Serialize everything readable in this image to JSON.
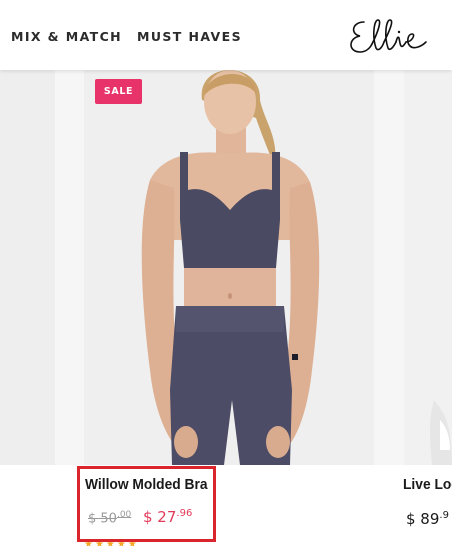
{
  "header": {
    "nav": [
      {
        "label": "MIX & MATCH"
      },
      {
        "label": "MUST HAVES"
      }
    ],
    "logo_text": "Ellie"
  },
  "products": {
    "main": {
      "badge": "SALE",
      "name": "Willow Molded Bra",
      "old_price_main": "$ 50",
      "old_price_cents": ".00",
      "price_main": "$ 27",
      "price_cents": ".96",
      "rating_stars": "★★★★★"
    },
    "right": {
      "name": "Live Lod",
      "price_main": "$ 89",
      "price_cents": ".9"
    }
  },
  "colors": {
    "sale_badge": "#e8336a",
    "sale_price": "#e23b5b",
    "highlight": "#d9252b",
    "outfit": "#4a4a62"
  }
}
